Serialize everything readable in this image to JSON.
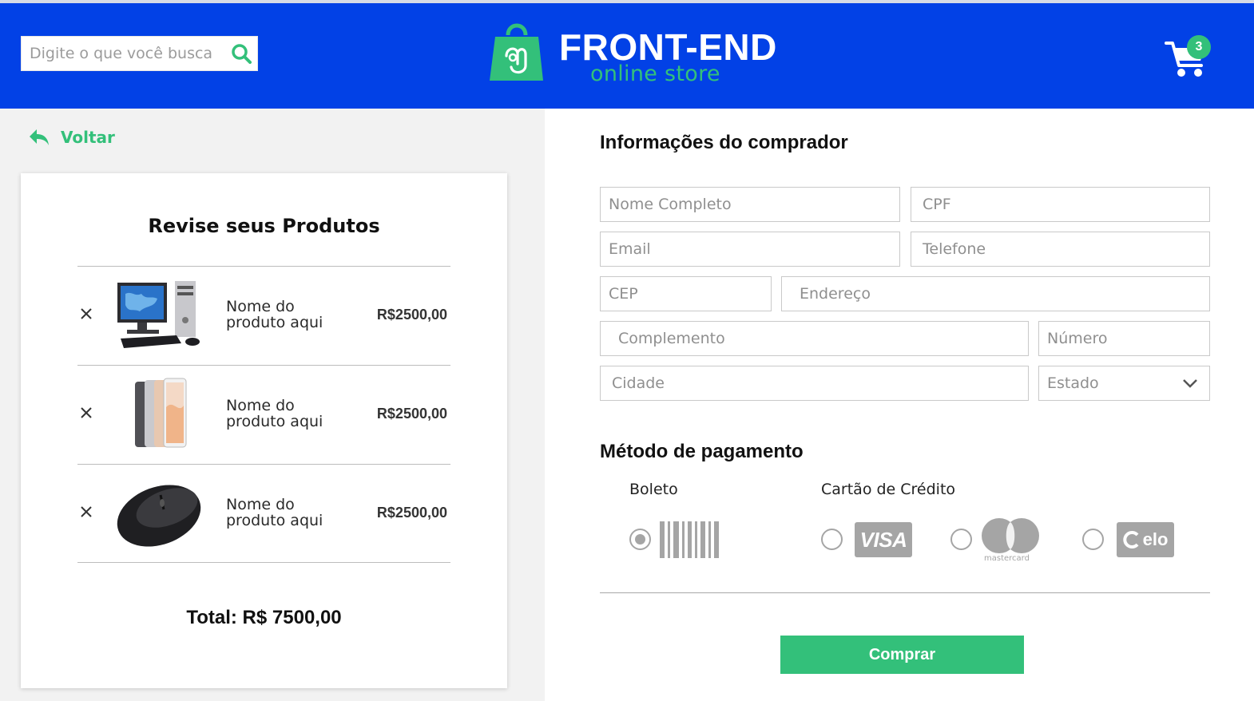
{
  "header": {
    "search_placeholder": "Digite o que você busca",
    "brand": "FRONT-END",
    "brand_sub": "online store",
    "cart_count": "3"
  },
  "back_label": "Voltar",
  "review": {
    "title": "Revise seus Produtos",
    "items": [
      {
        "name": "Nome do produto aqui",
        "price": "R$2500,00",
        "image": "desktop-computer"
      },
      {
        "name": "Nome do produto aqui",
        "price": "R$2500,00",
        "image": "tablets"
      },
      {
        "name": "Nome do produto aqui",
        "price": "R$2500,00",
        "image": "mouse"
      }
    ],
    "total": "Total: R$ 7500,00"
  },
  "buyer": {
    "title": "Informações do comprador",
    "fields": {
      "name": "Nome Completo",
      "cpf": "CPF",
      "email": "Email",
      "phone": "Telefone",
      "cep": "CEP",
      "address": "Endereço",
      "complement": "Complemento",
      "number": "Número",
      "city": "Cidade",
      "state": "Estado"
    }
  },
  "payment": {
    "title": "Método de pagamento",
    "boleto_label": "Boleto",
    "card_label": "Cartão de Crédito",
    "visa": "VISA",
    "mastercard": "mastercard",
    "elo": "elo",
    "selected": "boleto"
  },
  "buy_label": "Comprar",
  "colors": {
    "header_blue": "#0241e6",
    "accent_green": "#33c07a",
    "left_bg": "#f2f2f2",
    "icon_gray": "#a5a5a5"
  }
}
